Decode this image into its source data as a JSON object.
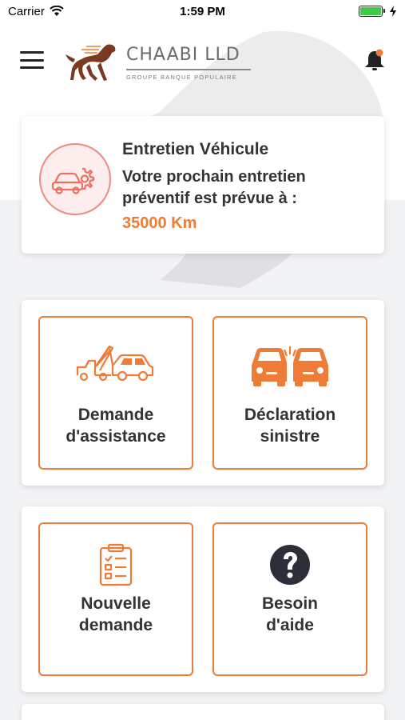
{
  "status_bar": {
    "carrier": "Carrier",
    "time": "1:59 PM",
    "battery_level": 1.0,
    "icons": [
      "wifi-icon",
      "battery-icon",
      "charging-icon"
    ]
  },
  "header": {
    "brand_name": "CHAABI LLD",
    "brand_subtitle": "GROUPE BANQUE POPULAIRE",
    "icons": [
      "menu-icon",
      "horse-logo-icon",
      "notification-bell-icon"
    ],
    "notification_dot_color": "#ee7b36"
  },
  "maintenance": {
    "title": "Entretien Véhicule",
    "message": "Votre prochain entretien préventif est prévue à :",
    "mileage": "35000 Km",
    "icon": "car-gear-icon"
  },
  "tiles": [
    {
      "label_line1": "Demande",
      "label_line2": "d'assistance",
      "icon": "tow-truck-icon"
    },
    {
      "label_line1": "Déclaration",
      "label_line2": "sinistre",
      "icon": "car-crash-icon"
    },
    {
      "label_line1": "Nouvelle",
      "label_line2": "demande",
      "icon": "clipboard-list-icon"
    },
    {
      "label_line1": "Besoin",
      "label_line2": "d'aide",
      "icon": "help-circle-icon"
    }
  ],
  "colors": {
    "accent": "#ee7b36",
    "maintenance_icon_border": "#f08a80",
    "text": "#333333",
    "background": "#f2f3f5"
  }
}
